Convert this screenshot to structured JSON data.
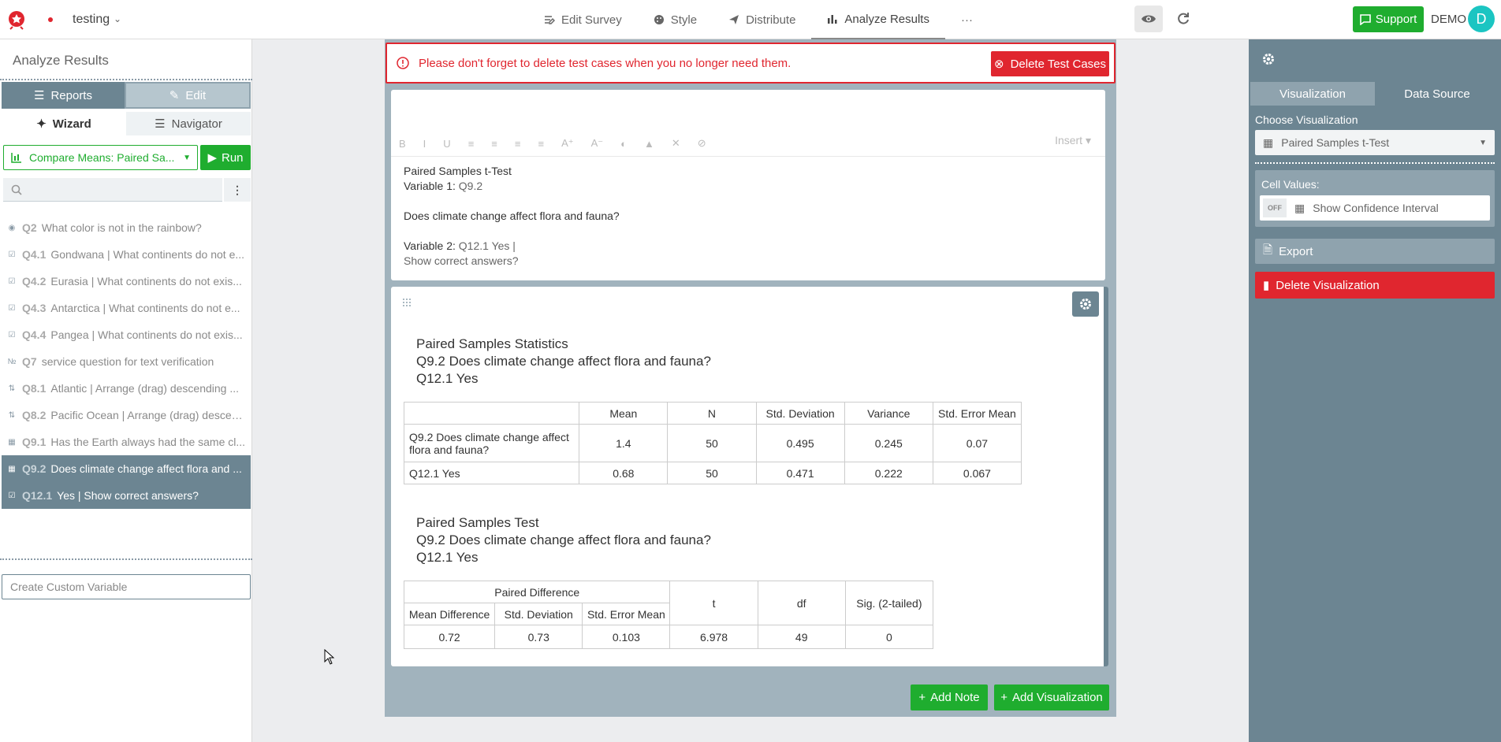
{
  "header": {
    "survey_name": "testing",
    "nav": [
      {
        "label": "Edit Survey",
        "icon": "edit-survey-icon"
      },
      {
        "label": "Style",
        "icon": "palette-icon"
      },
      {
        "label": "Distribute",
        "icon": "send-icon"
      },
      {
        "label": "Analyze Results",
        "icon": "bar-chart-icon",
        "active": true
      },
      {
        "label": "···",
        "icon": "more-icon"
      }
    ],
    "support_label": "Support",
    "demo_label": "DEMO",
    "avatar_letter": "D"
  },
  "sidebar": {
    "title": "Analyze Results",
    "seg": {
      "reports": "Reports",
      "edit": "Edit"
    },
    "subtabs": {
      "wizard": "Wizard",
      "navigator": "Navigator"
    },
    "analysis_select": "Compare Means: Paired Sa...",
    "run_label": "Run",
    "questions": [
      {
        "id": "Q2",
        "text": "What color is not in the rainbow?",
        "icon": "radio-icon"
      },
      {
        "id": "Q4.1",
        "text": "Gondwana | What continents do not e...",
        "icon": "checkbox-icon"
      },
      {
        "id": "Q4.2",
        "text": "Eurasia | What continents do not exis...",
        "icon": "checkbox-icon"
      },
      {
        "id": "Q4.3",
        "text": "Antarctica | What continents do not e...",
        "icon": "checkbox-icon"
      },
      {
        "id": "Q4.4",
        "text": "Pangea | What continents do not exis...",
        "icon": "checkbox-icon"
      },
      {
        "id": "Q7",
        "text": "service question for text verification",
        "icon": "numeric-icon"
      },
      {
        "id": "Q8.1",
        "text": "Atlantic | Arrange (drag) descending ...",
        "icon": "rank-icon"
      },
      {
        "id": "Q8.2",
        "text": "Pacific Ocean | Arrange (drag) descen...",
        "icon": "rank-icon"
      },
      {
        "id": "Q9.1",
        "text": "Has the Earth always had the same cl...",
        "icon": "matrix-icon"
      },
      {
        "id": "Q9.2",
        "text": "Does climate change affect flora and ...",
        "icon": "matrix-icon",
        "selected": true
      },
      {
        "id": "Q12.1",
        "text": "Yes | Show correct answers?",
        "icon": "checkbox-icon",
        "selected": true
      }
    ],
    "custom_variable_placeholder": "Create Custom Variable"
  },
  "alert": {
    "text": "Please don't forget to delete test cases when you no longer need them.",
    "button": "Delete Test Cases"
  },
  "editor": {
    "insert_label": "Insert",
    "toolbar": [
      "B",
      "I",
      "U"
    ],
    "title": "Paired Samples t-Test",
    "var1_label": "Variable 1:",
    "var1_value": "Q9.2",
    "question_text": "Does climate change affect flora and fauna?",
    "var2_label": "Variable 2:",
    "var2_value": "Q12.1 Yes |",
    "var2_value_2": "Show correct answers?"
  },
  "stats": {
    "title1": "Paired Samples Statistics",
    "subtitle1": "Q9.2 Does climate change affect flora and fauna?",
    "subtitle1b": "Q12.1 Yes",
    "headers": [
      "",
      "Mean",
      "N",
      "Std. Deviation",
      "Variance",
      "Std. Error Mean"
    ],
    "rows": [
      [
        "Q9.2 Does climate change affect flora and fauna?",
        "1.4",
        "50",
        "0.495",
        "0.245",
        "0.07"
      ],
      [
        "Q12.1 Yes",
        "0.68",
        "50",
        "0.471",
        "0.222",
        "0.067"
      ]
    ],
    "title2": "Paired Samples Test",
    "subtitle2": "Q9.2 Does climate change affect flora and fauna?",
    "subtitle2b": "Q12.1 Yes",
    "paired_header": "Paired Difference",
    "test_headers": [
      "Mean Difference",
      "Std. Deviation",
      "Std. Error Mean",
      "t",
      "df",
      "Sig. (2-tailed)"
    ],
    "test_row": [
      "0.72",
      "0.73",
      "0.103",
      "6.978",
      "49",
      "0"
    ]
  },
  "actions": {
    "add_note": "Add Note",
    "add_visualization": "Add Visualization"
  },
  "right": {
    "tabs": {
      "visualization": "Visualization",
      "data_source": "Data Source"
    },
    "choose_label": "Choose Visualization",
    "viz_select": "Paired Samples t-Test",
    "cell_values_label": "Cell Values:",
    "off_label": "OFF",
    "confidence_label": "Show Confidence Interval",
    "export_label": "Export",
    "delete_label": "Delete Visualization"
  },
  "colors": {
    "green": "#1fad2f",
    "red": "#e0262f",
    "slate": "#6c8592",
    "slate_light": "#a1b3bd"
  }
}
